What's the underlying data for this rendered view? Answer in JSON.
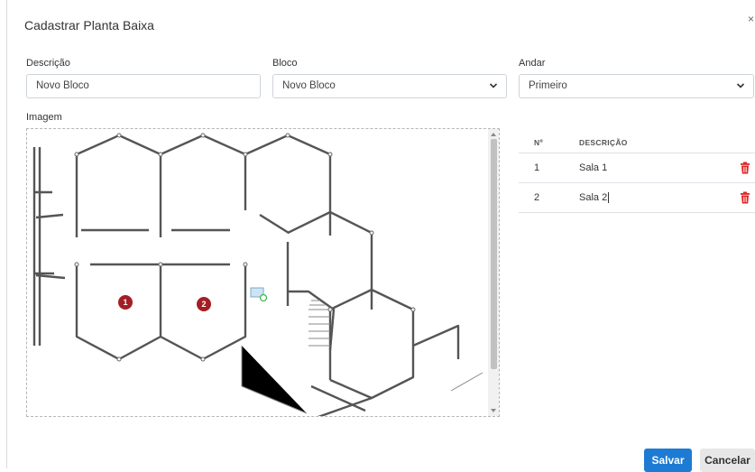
{
  "dialog": {
    "title": "Cadastrar Planta Baixa",
    "close_symbol": "×"
  },
  "form": {
    "descricao": {
      "label": "Descrição",
      "value": "Novo Bloco"
    },
    "bloco": {
      "label": "Bloco",
      "value": "Novo Bloco"
    },
    "andar": {
      "label": "Andar",
      "value": "Primeiro"
    },
    "imagem": {
      "label": "Imagem"
    }
  },
  "floorplan": {
    "markers": [
      {
        "label": "1",
        "color": "#a31f24"
      },
      {
        "label": "2",
        "color": "#a31f24"
      }
    ]
  },
  "table": {
    "headers": {
      "num": "Nº",
      "desc": "DESCRIÇÃO"
    },
    "rows": [
      {
        "num": "1",
        "desc": "Sala 1"
      },
      {
        "num": "2",
        "desc": "Sala 2"
      }
    ],
    "delete_icon": "trash-icon",
    "delete_color": "#e02424"
  },
  "footer": {
    "save_label": "Salvar",
    "cancel_label": "Cancelar",
    "save_color": "#1e7bd4"
  }
}
